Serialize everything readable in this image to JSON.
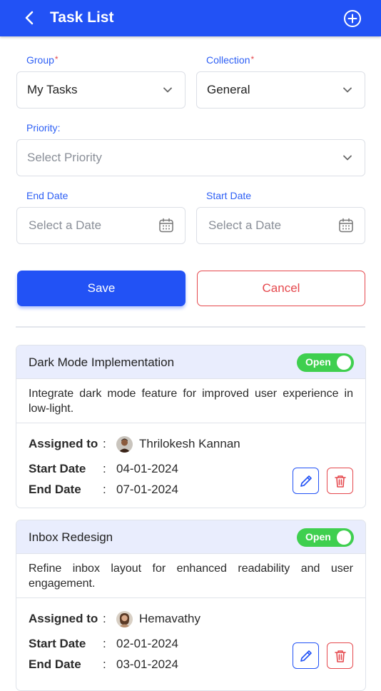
{
  "header": {
    "title": "Task List",
    "back_icon": "chevron-left-icon",
    "add_icon": "plus-circle-icon"
  },
  "form": {
    "group": {
      "label": "Group",
      "required": "*",
      "value": "My Tasks"
    },
    "collection": {
      "label": "Collection",
      "required": "*",
      "value": "General"
    },
    "priority": {
      "label": "Priority",
      "colon": ":",
      "placeholder": "Select Priority"
    },
    "end_date": {
      "label": "End Date",
      "placeholder": "Select a Date"
    },
    "start_date": {
      "label": "Start Date",
      "placeholder": "Select a Date"
    },
    "save_label": "Save",
    "cancel_label": "Cancel"
  },
  "colors": {
    "primary": "#2252f5",
    "danger": "#e5484d",
    "toggle_on": "#3fcf4f",
    "card_header": "#e9edfd"
  },
  "tasks": [
    {
      "title": "Dark Mode Implementation",
      "status": "Open",
      "description": "Integrate dark mode feature for improved user experience in low-light.",
      "assigned_label": "Assigned to",
      "assignee": "Thrilokesh Kannan",
      "start_label": "Start Date",
      "start_date": "04-01-2024",
      "end_label": "End Date",
      "end_date": "07-01-2024"
    },
    {
      "title": "Inbox Redesign",
      "status": "Open",
      "description": "Refine inbox layout for enhanced readability and user engagement.",
      "assigned_label": "Assigned to",
      "assignee": "Hemavathy",
      "start_label": "Start Date",
      "start_date": "02-01-2024",
      "end_label": "End Date",
      "end_date": "03-01-2024"
    }
  ],
  "separator": ":"
}
